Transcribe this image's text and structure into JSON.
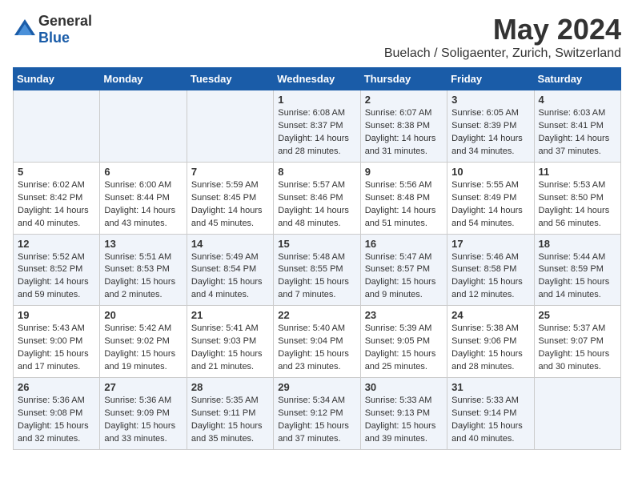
{
  "header": {
    "logo_general": "General",
    "logo_blue": "Blue",
    "month_title": "May 2024",
    "location": "Buelach / Soligaenter, Zurich, Switzerland"
  },
  "weekdays": [
    "Sunday",
    "Monday",
    "Tuesday",
    "Wednesday",
    "Thursday",
    "Friday",
    "Saturday"
  ],
  "weeks": [
    [
      {
        "day": "",
        "info": ""
      },
      {
        "day": "",
        "info": ""
      },
      {
        "day": "",
        "info": ""
      },
      {
        "day": "1",
        "info": "Sunrise: 6:08 AM\nSunset: 8:37 PM\nDaylight: 14 hours\nand 28 minutes."
      },
      {
        "day": "2",
        "info": "Sunrise: 6:07 AM\nSunset: 8:38 PM\nDaylight: 14 hours\nand 31 minutes."
      },
      {
        "day": "3",
        "info": "Sunrise: 6:05 AM\nSunset: 8:39 PM\nDaylight: 14 hours\nand 34 minutes."
      },
      {
        "day": "4",
        "info": "Sunrise: 6:03 AM\nSunset: 8:41 PM\nDaylight: 14 hours\nand 37 minutes."
      }
    ],
    [
      {
        "day": "5",
        "info": "Sunrise: 6:02 AM\nSunset: 8:42 PM\nDaylight: 14 hours\nand 40 minutes."
      },
      {
        "day": "6",
        "info": "Sunrise: 6:00 AM\nSunset: 8:44 PM\nDaylight: 14 hours\nand 43 minutes."
      },
      {
        "day": "7",
        "info": "Sunrise: 5:59 AM\nSunset: 8:45 PM\nDaylight: 14 hours\nand 45 minutes."
      },
      {
        "day": "8",
        "info": "Sunrise: 5:57 AM\nSunset: 8:46 PM\nDaylight: 14 hours\nand 48 minutes."
      },
      {
        "day": "9",
        "info": "Sunrise: 5:56 AM\nSunset: 8:48 PM\nDaylight: 14 hours\nand 51 minutes."
      },
      {
        "day": "10",
        "info": "Sunrise: 5:55 AM\nSunset: 8:49 PM\nDaylight: 14 hours\nand 54 minutes."
      },
      {
        "day": "11",
        "info": "Sunrise: 5:53 AM\nSunset: 8:50 PM\nDaylight: 14 hours\nand 56 minutes."
      }
    ],
    [
      {
        "day": "12",
        "info": "Sunrise: 5:52 AM\nSunset: 8:52 PM\nDaylight: 14 hours\nand 59 minutes."
      },
      {
        "day": "13",
        "info": "Sunrise: 5:51 AM\nSunset: 8:53 PM\nDaylight: 15 hours\nand 2 minutes."
      },
      {
        "day": "14",
        "info": "Sunrise: 5:49 AM\nSunset: 8:54 PM\nDaylight: 15 hours\nand 4 minutes."
      },
      {
        "day": "15",
        "info": "Sunrise: 5:48 AM\nSunset: 8:55 PM\nDaylight: 15 hours\nand 7 minutes."
      },
      {
        "day": "16",
        "info": "Sunrise: 5:47 AM\nSunset: 8:57 PM\nDaylight: 15 hours\nand 9 minutes."
      },
      {
        "day": "17",
        "info": "Sunrise: 5:46 AM\nSunset: 8:58 PM\nDaylight: 15 hours\nand 12 minutes."
      },
      {
        "day": "18",
        "info": "Sunrise: 5:44 AM\nSunset: 8:59 PM\nDaylight: 15 hours\nand 14 minutes."
      }
    ],
    [
      {
        "day": "19",
        "info": "Sunrise: 5:43 AM\nSunset: 9:00 PM\nDaylight: 15 hours\nand 17 minutes."
      },
      {
        "day": "20",
        "info": "Sunrise: 5:42 AM\nSunset: 9:02 PM\nDaylight: 15 hours\nand 19 minutes."
      },
      {
        "day": "21",
        "info": "Sunrise: 5:41 AM\nSunset: 9:03 PM\nDaylight: 15 hours\nand 21 minutes."
      },
      {
        "day": "22",
        "info": "Sunrise: 5:40 AM\nSunset: 9:04 PM\nDaylight: 15 hours\nand 23 minutes."
      },
      {
        "day": "23",
        "info": "Sunrise: 5:39 AM\nSunset: 9:05 PM\nDaylight: 15 hours\nand 25 minutes."
      },
      {
        "day": "24",
        "info": "Sunrise: 5:38 AM\nSunset: 9:06 PM\nDaylight: 15 hours\nand 28 minutes."
      },
      {
        "day": "25",
        "info": "Sunrise: 5:37 AM\nSunset: 9:07 PM\nDaylight: 15 hours\nand 30 minutes."
      }
    ],
    [
      {
        "day": "26",
        "info": "Sunrise: 5:36 AM\nSunset: 9:08 PM\nDaylight: 15 hours\nand 32 minutes."
      },
      {
        "day": "27",
        "info": "Sunrise: 5:36 AM\nSunset: 9:09 PM\nDaylight: 15 hours\nand 33 minutes."
      },
      {
        "day": "28",
        "info": "Sunrise: 5:35 AM\nSunset: 9:11 PM\nDaylight: 15 hours\nand 35 minutes."
      },
      {
        "day": "29",
        "info": "Sunrise: 5:34 AM\nSunset: 9:12 PM\nDaylight: 15 hours\nand 37 minutes."
      },
      {
        "day": "30",
        "info": "Sunrise: 5:33 AM\nSunset: 9:13 PM\nDaylight: 15 hours\nand 39 minutes."
      },
      {
        "day": "31",
        "info": "Sunrise: 5:33 AM\nSunset: 9:14 PM\nDaylight: 15 hours\nand 40 minutes."
      },
      {
        "day": "",
        "info": ""
      }
    ]
  ]
}
